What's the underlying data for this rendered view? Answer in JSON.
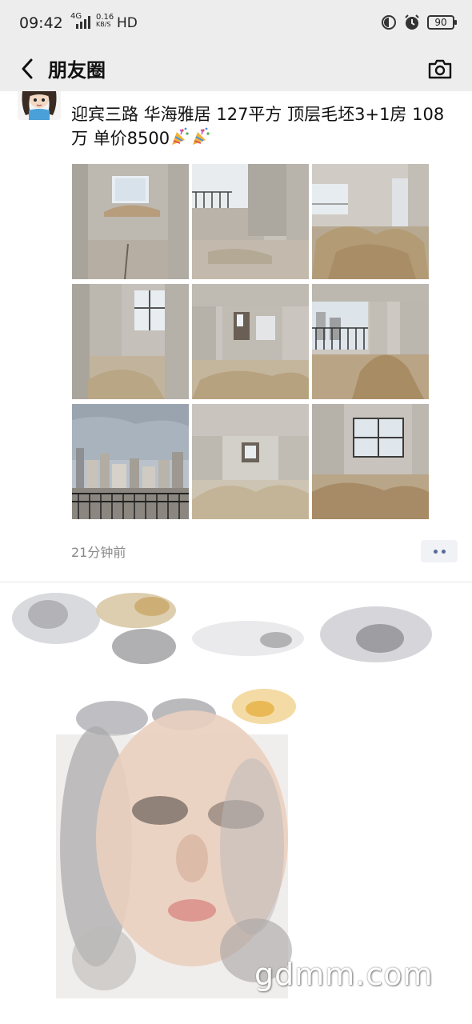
{
  "status_bar": {
    "time": "09:42",
    "network": "4G",
    "speed_value": "0.16",
    "speed_unit": "KB/S",
    "hd": "HD",
    "battery": "90"
  },
  "header": {
    "title": "朋友圈",
    "back_icon": "chevron-left-icon",
    "camera_icon": "camera-icon"
  },
  "post": {
    "text": "迎宾三路 华海雅居 127平方 顶层毛坯3+1房 108万 单价8500",
    "emoji_icon": "party-popper-icon",
    "time": "21分钟前",
    "photos": [
      "unfinished-room-with-window",
      "unfinished-room-with-balcony",
      "unfinished-living-room-sand",
      "unfinished-bathroom",
      "unfinished-hallway",
      "unfinished-room-balcony-view",
      "city-view-from-balcony",
      "unfinished-hall-sand",
      "unfinished-bedroom-window"
    ]
  },
  "watermark": "gdmm.com",
  "colors": {
    "header_bg": "#ededed",
    "link_blue": "#576b95",
    "time_gray": "#888888"
  }
}
